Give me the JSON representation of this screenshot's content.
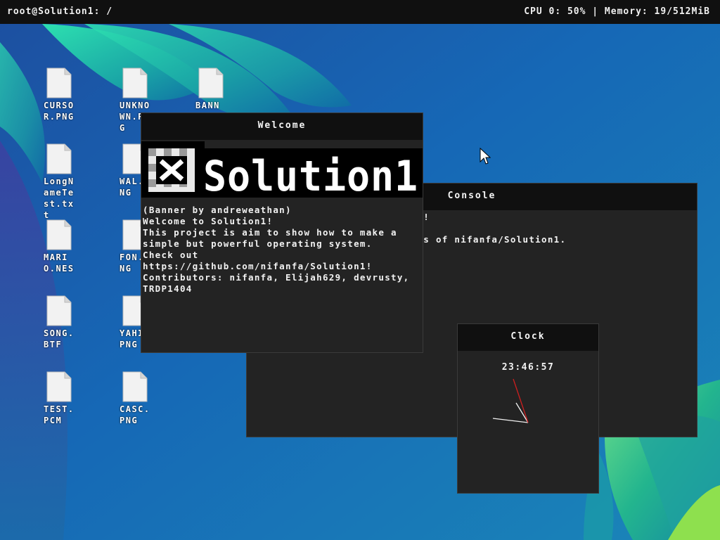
{
  "topbar": {
    "prompt": "root@Solution1: /",
    "status": "CPU 0: 50% | Memory: 19/512MiB"
  },
  "desktop": {
    "icons": [
      {
        "label": "CURSOR.PNG"
      },
      {
        "label": "UNKNOWN.PNG"
      },
      {
        "label": "BANN"
      },
      {
        "label": "LongNameTest.txt"
      },
      {
        "label": "WAL.PNG"
      },
      {
        "label": "MARIO.NES"
      },
      {
        "label": "FON.PNG"
      },
      {
        "label": "SONG.BTF"
      },
      {
        "label": "YAHI.PNG"
      },
      {
        "label": "TEST.PCM"
      },
      {
        "label": "CASC.PNG"
      }
    ]
  },
  "welcome_window": {
    "title": "Welcome",
    "logo_text": "Solution1",
    "text": "(Banner by andreweathan)\nWelcome to Solution1!\nThis project is aim to show how to make a simple but powerful operating system.\nCheck out https://github.com/nifanfa/Solution1!\nContributors: nifanfa, Elijah629, devrusty, TRDP1404"
  },
  "console_window": {
    "title": "Console",
    "line1": "ion1!",
    "line2": "utors of nifanfa/Solution1."
  },
  "clock_window": {
    "title": "Clock",
    "time": "23:46:57"
  },
  "colors": {
    "second_hand": "#cc1f1f",
    "window_bg": "#232323",
    "titlebar_bg": "#101010"
  }
}
